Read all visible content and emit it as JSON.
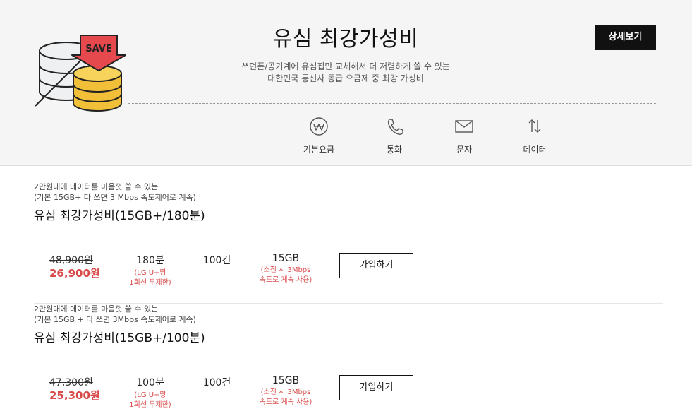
{
  "hero": {
    "badge_text": "SAVE",
    "title": "유심 최강가성비",
    "desc_line1": "쓰던폰/공기계에 유심칩만 교체해서 더 저렴하게 쓸 수 있는",
    "desc_line2": "대한민국 통신사 동급 요금제 중 최강 가성비",
    "detail_button": "상세보기"
  },
  "features": [
    {
      "label": "기본요금",
      "icon": "won-coin-icon"
    },
    {
      "label": "통화",
      "icon": "phone-icon"
    },
    {
      "label": "문자",
      "icon": "envelope-icon"
    },
    {
      "label": "데이터",
      "icon": "data-arrows-icon"
    }
  ],
  "plans": [
    {
      "desc_line1": "2만원대에 데이터를 마음껏 쓸 수 있는",
      "desc_line2": "(기본 15GB+ 다 쓰면 3 Mbps 속도제어로 계속)",
      "name": "유심 최강가성비(15GB+/180분)",
      "original_price": "48,900원",
      "sale_price": "26,900원",
      "call": "180분",
      "call_note_line1": "(LG U+망",
      "call_note_line2": "1회선 무제한)",
      "sms": "100건",
      "data": "15GB",
      "data_note_line1": "(소진 시 3Mbps",
      "data_note_line2": "속도로 계속 사용)",
      "join_button": "가입하기"
    },
    {
      "desc_line1": "2만원대에 데이터를 마음껏 쓸 수 있는",
      "desc_line2": "(기본 15GB + 다 쓰면 3Mbps 속도제어로 계속)",
      "name": "유심 최강가성비(15GB+/100분)",
      "original_price": "47,300원",
      "sale_price": "25,300원",
      "call": "100분",
      "call_note_line1": "(LG U+망",
      "call_note_line2": "1회선 무제한)",
      "sms": "100건",
      "data": "15GB",
      "data_note_line1": "(소진 시 3Mbps",
      "data_note_line2": "속도로 계속 사용)",
      "join_button": "가입하기"
    }
  ],
  "colors": {
    "accent_red": "#d84a4a",
    "coin_gold": "#f2c038",
    "save_red": "#e5484d",
    "button_dark": "#111111"
  }
}
